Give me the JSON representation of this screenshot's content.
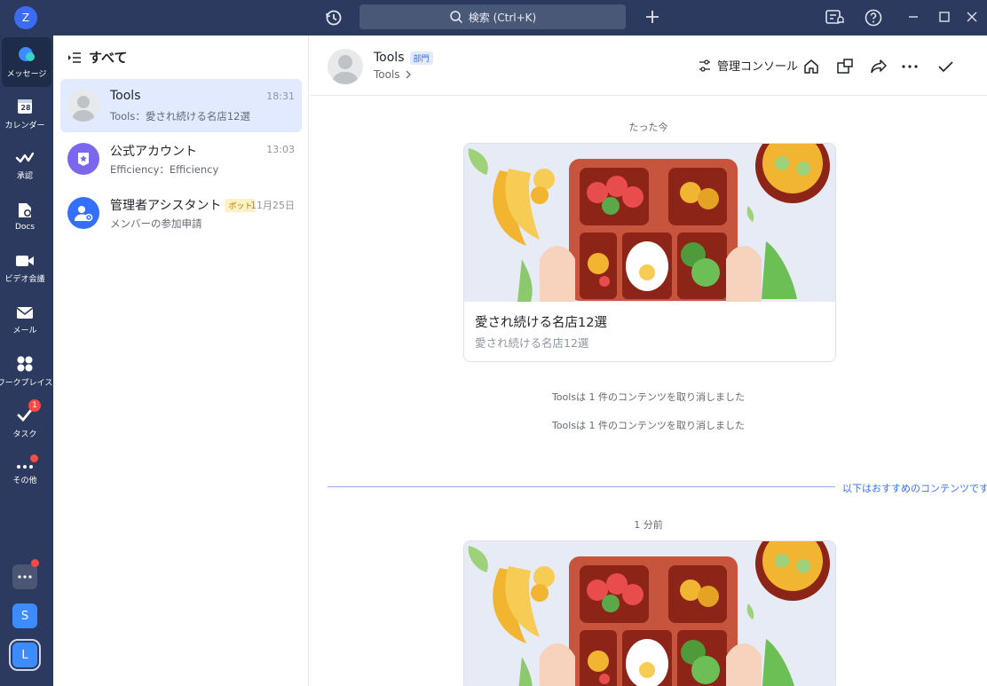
{
  "topbar": {
    "user_initial": "Z",
    "search_placeholder": "検索 (Ctrl+K)"
  },
  "rail": {
    "items": [
      {
        "label": "メッセージ",
        "icon": "message-icon"
      },
      {
        "label": "カレンダー",
        "icon": "calendar-icon",
        "day": "28"
      },
      {
        "label": "承認",
        "icon": "approval-icon"
      },
      {
        "label": "Docs",
        "icon": "docs-icon"
      },
      {
        "label": "ビデオ会議",
        "icon": "video-icon"
      },
      {
        "label": "メール",
        "icon": "mail-icon"
      },
      {
        "label": "ワークプレイス",
        "icon": "workplace-icon"
      },
      {
        "label": "タスク",
        "icon": "task-icon",
        "badge": "1"
      },
      {
        "label": "その他",
        "icon": "more-icon"
      }
    ],
    "workspaces": [
      "S",
      "L"
    ]
  },
  "list": {
    "header": "すべて",
    "chats": [
      {
        "name": "Tools",
        "preview": "Tools：愛され続ける名店12選",
        "time": "18:31"
      },
      {
        "name": "公式アカウント",
        "preview": "Efficiency：Efficiency",
        "time": "13:03"
      },
      {
        "name": "管理者アシスタント",
        "tag": "ボット",
        "preview": "メンバーの参加申請",
        "time": "11月25日"
      }
    ]
  },
  "main": {
    "title": "Tools",
    "tag": "部門",
    "subtitle": "Tools",
    "console_label": "管理コンソール",
    "messages": {
      "stamp1": "たった今",
      "card1_title": "愛され続ける名店12選",
      "card1_sub": "愛され続ける名店12選",
      "sys1": "Toolsは 1 件のコンテンツを取り消しました",
      "sys2": "Toolsは 1 件のコンテンツを取り消しました",
      "divider": "以下はおすすめのコンテンツです",
      "stamp2": "1 分前"
    }
  },
  "colors": {
    "sidebar": "#2b3a5e",
    "accent": "#3370ff",
    "selected": "#e1eaff"
  }
}
